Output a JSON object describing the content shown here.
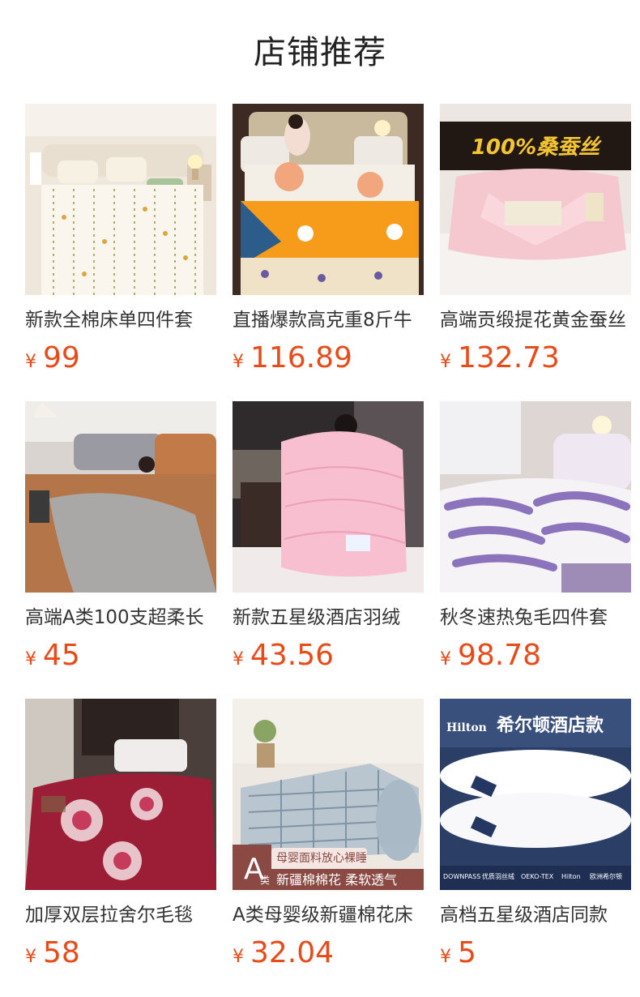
{
  "section_title": "店铺推荐",
  "currency_symbol": "¥",
  "accent_color": "#e84a18",
  "products": [
    {
      "name": "新款全棉床单四件套",
      "price": "99",
      "image": "white-floral-bedding"
    },
    {
      "name": "直播爆款高克重8斤牛",
      "price": "116.89",
      "image": "orange-floral-bedding"
    },
    {
      "name": "高端贡缎提花黄金蚕丝",
      "price": "132.73",
      "image": "pink-silk-quilt",
      "banner": "100%桑蚕丝"
    },
    {
      "name": "高端A类100支超柔长",
      "price": "45",
      "image": "orange-gray-bedding"
    },
    {
      "name": "新款五星级酒店羽绒",
      "price": "43.56",
      "image": "pink-down-quilt"
    },
    {
      "name": "秋冬速热兔毛四件套",
      "price": "98.78",
      "image": "purple-faux-fur-bedding"
    },
    {
      "name": "加厚双层拉舍尔毛毯",
      "price": "58",
      "image": "red-rose-blanket"
    },
    {
      "name": "A类母婴级新疆棉花床",
      "price": "32.04",
      "image": "plaid-mattress-topper",
      "badge_letter": "A",
      "badge_sub": "类",
      "tag_top": "母婴面料放心裸睡",
      "tag_bottom": "新疆棉棉花 柔软透气"
    },
    {
      "name": "高档五星级酒店同款",
      "price": "5",
      "image": "hotel-pillows",
      "brand": "Hilton",
      "headline": "希尔顿酒店款",
      "strip": [
        "DOWNPASS",
        "优质羽丝绒",
        "OEKO-TEX",
        "Hilton",
        "欧洲希尔顿"
      ]
    }
  ]
}
